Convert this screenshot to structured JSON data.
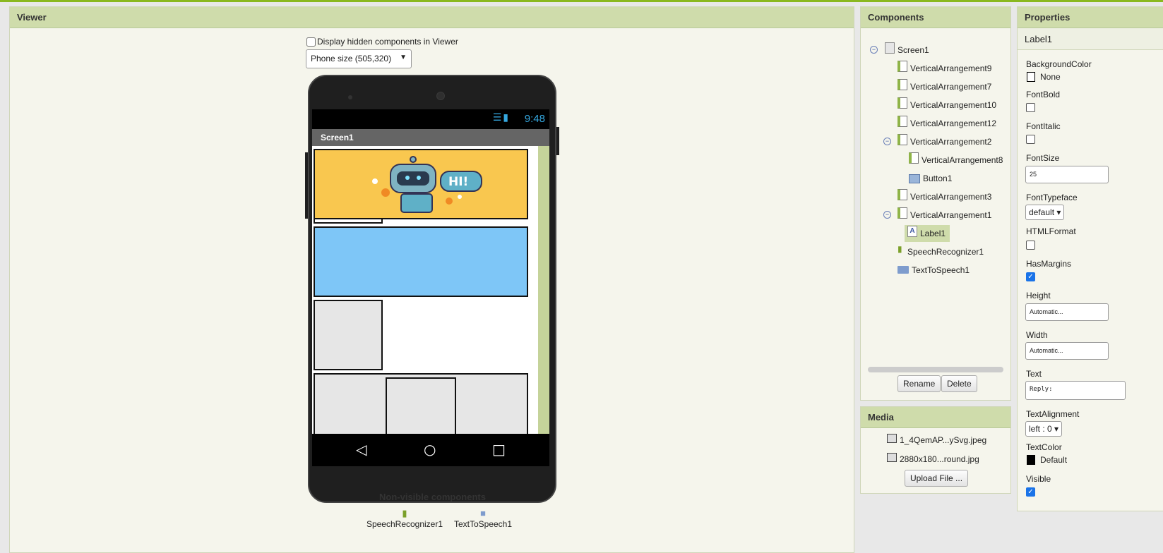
{
  "viewer": {
    "title": "Viewer",
    "hidden_label": "Display hidden components in Viewer",
    "size_select": "Phone size (505,320)",
    "phone": {
      "time": "9:48",
      "screen_title": "Screen1",
      "hi_text": "HI!"
    },
    "nonvisible_title": "Non-visible components",
    "nonvisible": [
      "SpeechRecognizer1",
      "TextToSpeech1"
    ]
  },
  "components": {
    "title": "Components",
    "tree": [
      {
        "label": "Screen1",
        "icon": "screen-icon",
        "collapsible": true
      },
      {
        "label": "VerticalArrangement9",
        "icon": "arrangement-icon"
      },
      {
        "label": "VerticalArrangement7",
        "icon": "arrangement-icon"
      },
      {
        "label": "VerticalArrangement10",
        "icon": "arrangement-icon"
      },
      {
        "label": "VerticalArrangement12",
        "icon": "arrangement-icon"
      },
      {
        "label": "VerticalArrangement2",
        "icon": "arrangement-icon",
        "collapsible": true
      },
      {
        "label": "VerticalArrangement8",
        "icon": "arrangement-icon"
      },
      {
        "label": "Button1",
        "icon": "button-icon"
      },
      {
        "label": "VerticalArrangement3",
        "icon": "arrangement-icon"
      },
      {
        "label": "VerticalArrangement1",
        "icon": "arrangement-icon",
        "collapsible": true
      },
      {
        "label": "Label1",
        "icon": "label-icon",
        "selected": true
      },
      {
        "label": "SpeechRecognizer1",
        "icon": "microphone-icon"
      },
      {
        "label": "TextToSpeech1",
        "icon": "speech-bubble-icon"
      }
    ],
    "rename_label": "Rename",
    "delete_label": "Delete"
  },
  "media": {
    "title": "Media",
    "files": [
      "1_4QemAP...ySvg.jpeg",
      "2880x180...round.jpg"
    ],
    "upload_label": "Upload File ..."
  },
  "properties": {
    "title": "Properties",
    "selected": "Label1",
    "background_color_label": "BackgroundColor",
    "background_color_value": "None",
    "font_bold_label": "FontBold",
    "font_bold": false,
    "font_italic_label": "FontItalic",
    "font_italic": false,
    "font_size_label": "FontSize",
    "font_size_value": "25",
    "font_typeface_label": "FontTypeface",
    "font_typeface_value": "default ▾",
    "html_format_label": "HTMLFormat",
    "html_format": false,
    "has_margins_label": "HasMargins",
    "has_margins": true,
    "height_label": "Height",
    "height_value": "Automatic...",
    "width_label": "Width",
    "width_value": "Automatic...",
    "text_label": "Text",
    "text_value": "Reply:",
    "text_alignment_label": "TextAlignment",
    "text_alignment_value": "left : 0 ▾",
    "text_color_label": "TextColor",
    "text_color_value": "Default",
    "visible_label": "Visible",
    "visible": true
  },
  "colors": {
    "header_bg": "#cfdcab",
    "accent_green": "#8ab820",
    "phone_block_yellow": "#f9c74f",
    "phone_block_blue": "#7ec6f7",
    "phone_block_gray": "#e6e6e6"
  }
}
